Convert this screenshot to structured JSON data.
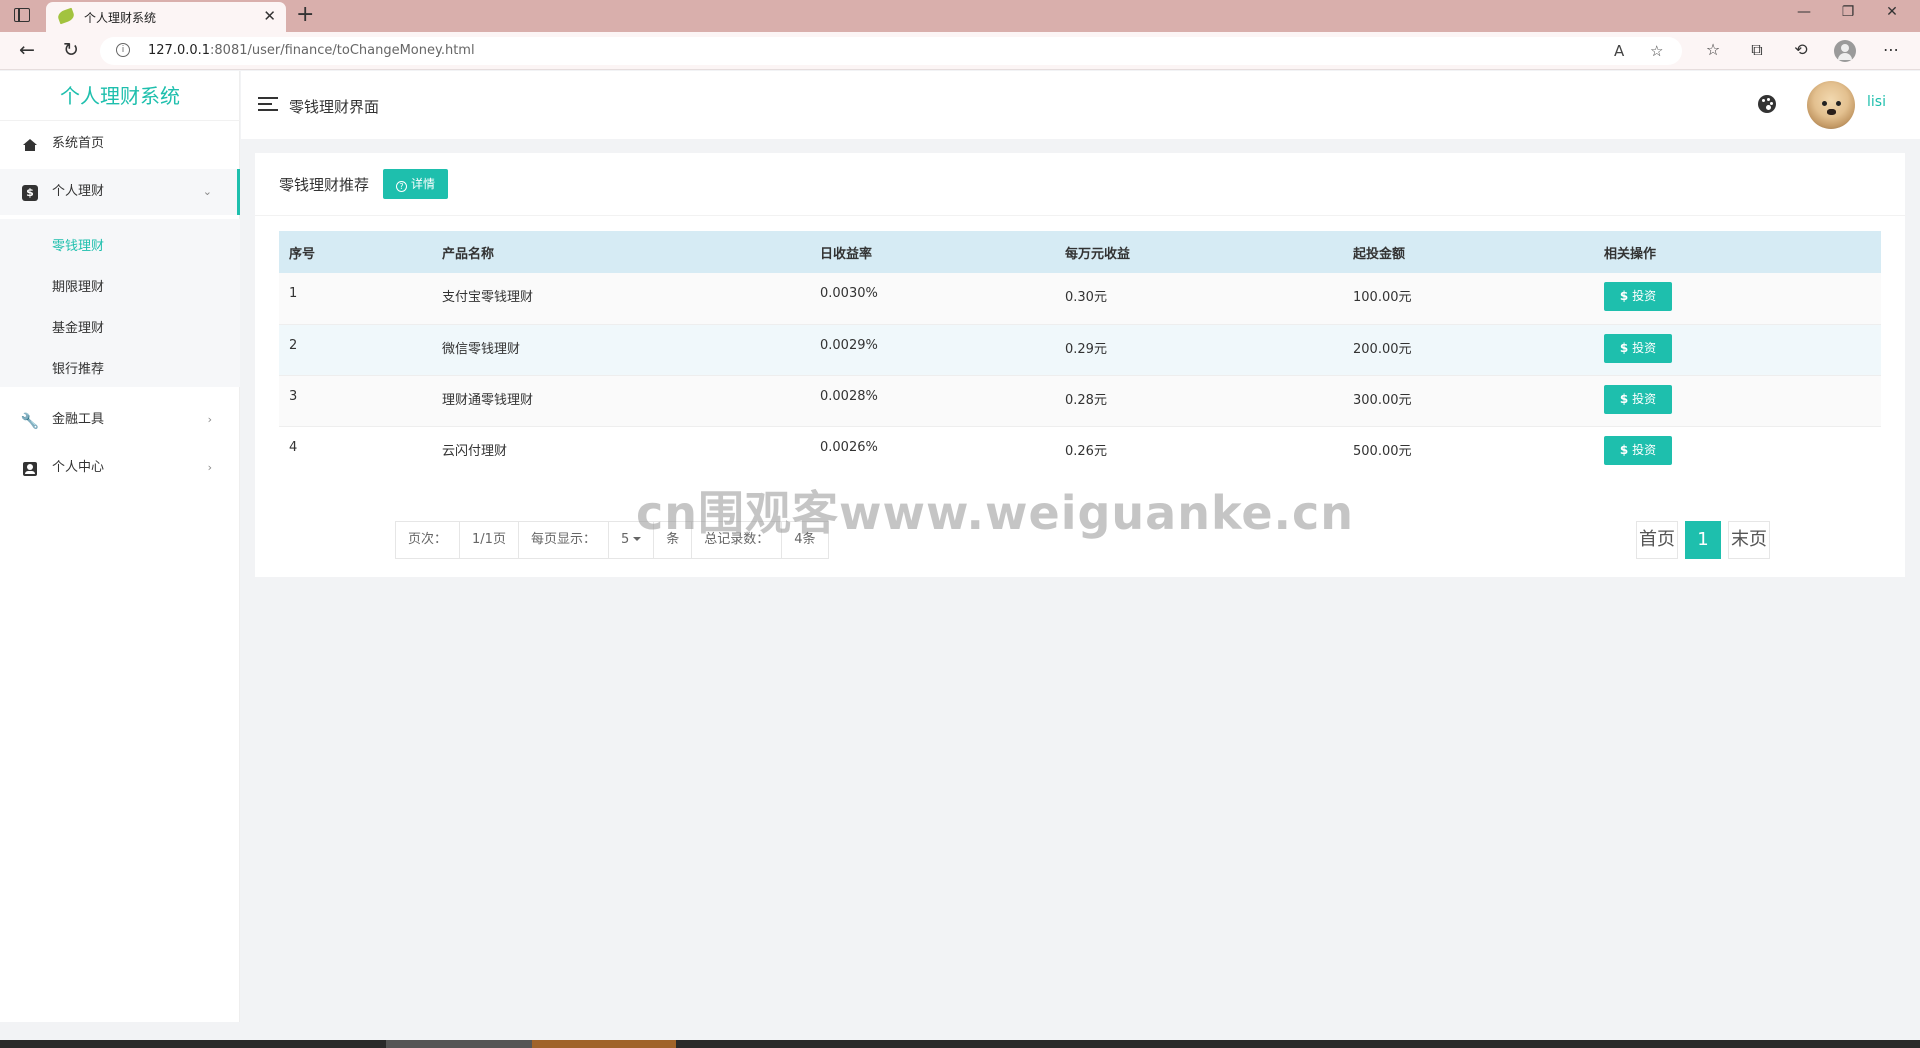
{
  "browser": {
    "tab_title": "个人理财系统",
    "url_host": "127.0.0.1",
    "url_rest": ":8081/user/finance/toChangeMoney.html"
  },
  "sidebar": {
    "logo": "个人理财系统",
    "items": [
      {
        "label": "系统首页",
        "icon": "home-icon"
      },
      {
        "label": "个人理财",
        "icon": "dollar-icon",
        "open": true
      },
      {
        "label": "金融工具",
        "icon": "wrench-icon"
      },
      {
        "label": "个人中心",
        "icon": "user-card-icon"
      }
    ],
    "sub_items": [
      {
        "label": "零钱理财",
        "active": true
      },
      {
        "label": "期限理财"
      },
      {
        "label": "基金理财"
      },
      {
        "label": "银行推荐"
      }
    ]
  },
  "header": {
    "title": "零钱理财界面",
    "username": "lisi"
  },
  "card": {
    "title": "零钱理财推荐",
    "detail_label": "详情",
    "columns": [
      "序号",
      "产品名称",
      "日收益率",
      "每万元收益",
      "起投金额",
      "相关操作"
    ],
    "rows": [
      {
        "id": "1",
        "name": "支付宝零钱理财",
        "rate": "0.0030%",
        "per_10k": "0.30元",
        "min": "100.00元"
      },
      {
        "id": "2",
        "name": "微信零钱理财",
        "rate": "0.0029%",
        "per_10k": "0.29元",
        "min": "200.00元"
      },
      {
        "id": "3",
        "name": "理财通零钱理财",
        "rate": "0.0028%",
        "per_10k": "0.28元",
        "min": "300.00元"
      },
      {
        "id": "4",
        "name": "云闪付理财",
        "rate": "0.0026%",
        "per_10k": "0.26元",
        "min": "500.00元"
      }
    ],
    "invest_label": "投资",
    "invest_symbol": "$"
  },
  "pagination": {
    "page_label": "页次：",
    "page_value": "1/1页",
    "per_page_label": "每页显示：",
    "per_page_value": "5",
    "per_page_unit": "条",
    "total_label": "总记录数：",
    "total_value": "4条",
    "first": "首页",
    "current": "1",
    "last": "末页"
  },
  "watermark": "cn围观客www.weiguanke.cn",
  "colors": {
    "accent": "#1ebfad",
    "table_header": "#d6ebf4"
  }
}
